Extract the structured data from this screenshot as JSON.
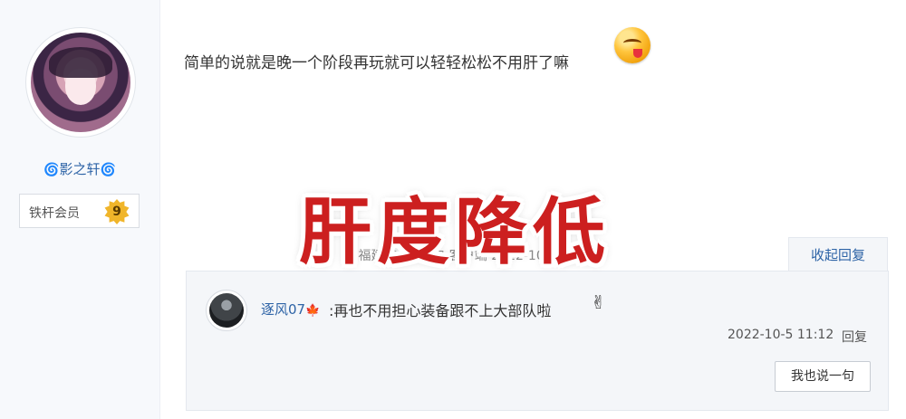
{
  "author": {
    "name": "影之轩",
    "decoration": "🌀",
    "member_title": "铁杆会员",
    "level": "9"
  },
  "post": {
    "text": "简单的说就是晚一个阶段再玩就可以轻轻松松不用肝了嘛",
    "emoji": "yum-face-emoji",
    "meta": "地   福建 ①  发   采自   客户端 2022-10-05 10:41",
    "collapse_reply": "收起回复"
  },
  "overlay": {
    "title": "肝度降低",
    "color": "#cc1f1f"
  },
  "reply": {
    "user": "逐风07",
    "user_icon": "maple-leaf-icon",
    "separator": ":",
    "text": "再也不用担心装备跟不上大部队啦",
    "emoji": "✌",
    "time": "2022-10-5 11:12",
    "reply_label": "回复",
    "say_button": "我也说一句"
  },
  "colors": {
    "link": "#2d63a6",
    "panel_bg": "#f4f6f9"
  }
}
